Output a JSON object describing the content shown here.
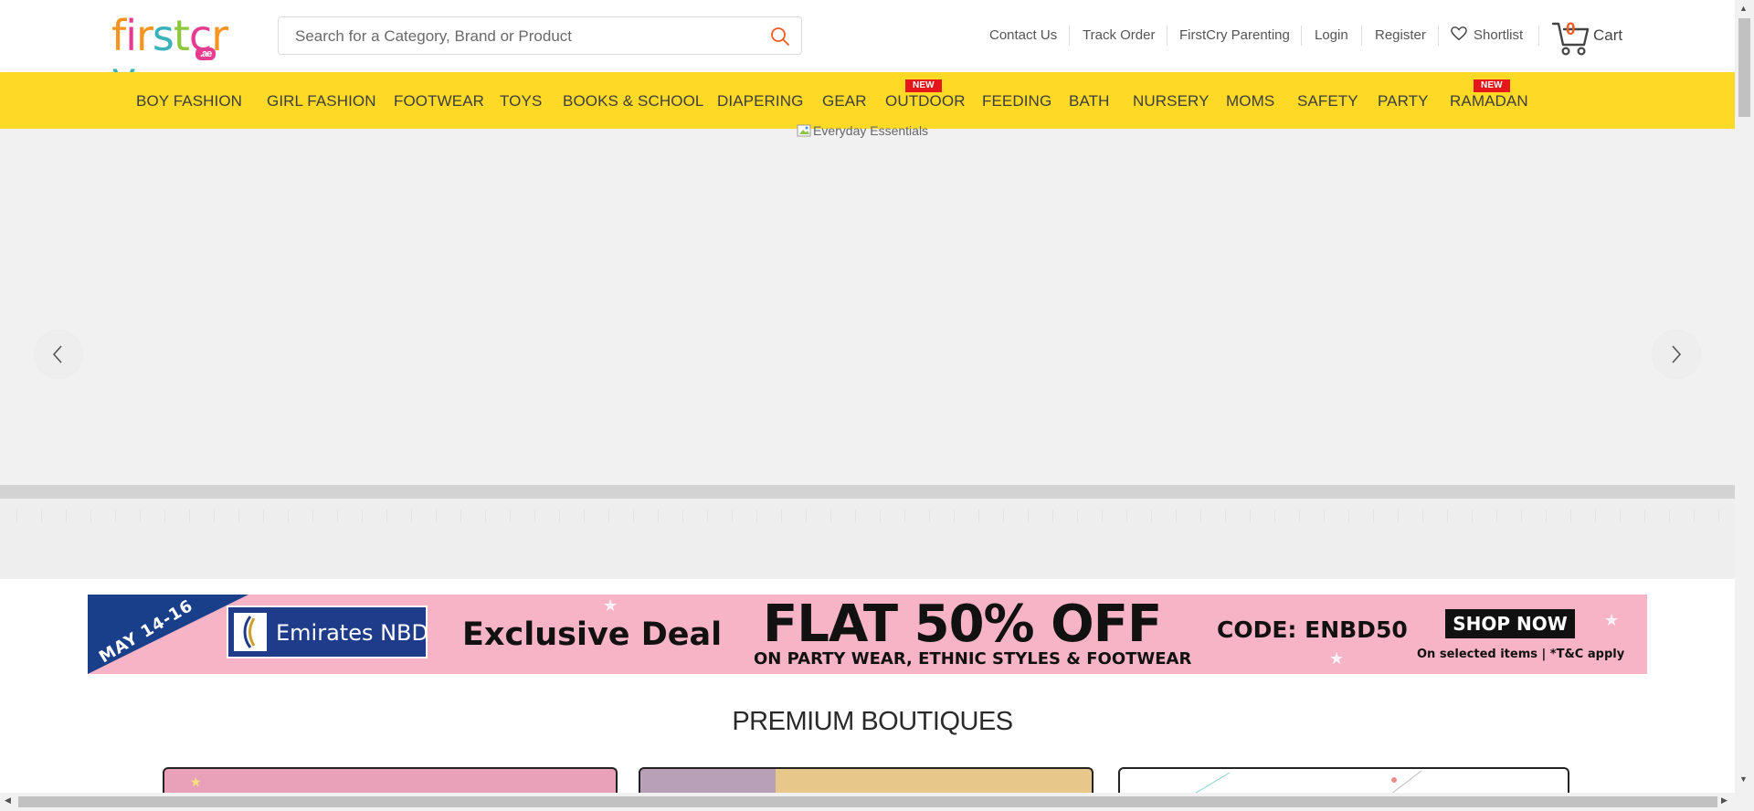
{
  "header": {
    "logo": {
      "text": "firstcry",
      "tld": ".ae",
      "letter_colors": [
        "#f7941d",
        "#e53c8f",
        "#f7941d",
        "#3ab2b9",
        "#8dc63f",
        "#e53c8f",
        "#f7941d",
        "#3ab2b9"
      ]
    },
    "search": {
      "placeholder": "Search for a Category, Brand or Product",
      "value": "",
      "icon": "search-icon"
    },
    "links": {
      "contact": "Contact Us",
      "track": "Track Order",
      "parenting": "FirstCry Parenting",
      "login": "Login",
      "register": "Register",
      "shortlist": "Shortlist"
    },
    "cart": {
      "count": "0",
      "label": "Cart",
      "icon": "cart-icon"
    }
  },
  "nav": {
    "items": [
      {
        "label": "BOY FASHION",
        "badge": ""
      },
      {
        "label": "GIRL FASHION",
        "badge": ""
      },
      {
        "label": "FOOTWEAR",
        "badge": ""
      },
      {
        "label": "TOYS",
        "badge": ""
      },
      {
        "label": "BOOKS & SCHOOL",
        "badge": ""
      },
      {
        "label": "DIAPERING",
        "badge": ""
      },
      {
        "label": "GEAR",
        "badge": ""
      },
      {
        "label": "OUTDOOR",
        "badge": "NEW"
      },
      {
        "label": "FEEDING",
        "badge": ""
      },
      {
        "label": "BATH",
        "badge": ""
      },
      {
        "label": "NURSERY",
        "badge": ""
      },
      {
        "label": "MOMS",
        "badge": ""
      },
      {
        "label": "SAFETY",
        "badge": ""
      },
      {
        "label": "PARTY",
        "badge": ""
      },
      {
        "label": "RAMADAN",
        "badge": "NEW"
      }
    ],
    "bg_color": "#fed925",
    "badge_color": "#e4171b"
  },
  "hero": {
    "alt_text": "Everyday Essentials",
    "prev_icon": "chevron-left-icon",
    "next_icon": "chevron-right-icon"
  },
  "promo": {
    "date": "MAY 14-16",
    "bank": "Emirates NBD",
    "deal": "Exclusive Deal",
    "headline": "FLAT 50% OFF",
    "subline": "ON PARTY WEAR, ETHNIC STYLES & FOOTWEAR",
    "code": "CODE: ENBD50",
    "cta": "SHOP NOW",
    "terms": "On selected items | *T&C apply",
    "bg_color": "#f7b4c6",
    "accent_color": "#1a3f8a"
  },
  "boutiques": {
    "title": "PREMIUM BOUTIQUES"
  }
}
